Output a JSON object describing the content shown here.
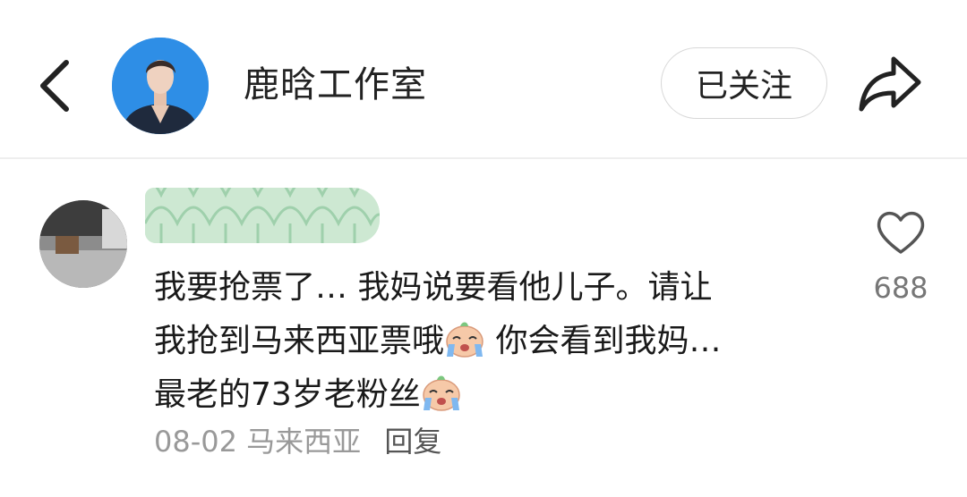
{
  "header": {
    "back_icon": "chevron-left-icon",
    "title": "鹿晗工作室",
    "follow_label": "已关注",
    "share_icon": "share-arrow-icon"
  },
  "comment": {
    "text_line1": "我要抢票了… 我妈说要看他儿子。请让",
    "text_line2_a": "我抢到马来西亚票哦",
    "text_line2_b": " 你会看到我妈…",
    "text_line3": "最老的73岁老粉丝",
    "emoji": "crying-peach-emoji",
    "date": "08-02",
    "location": "马来西亚",
    "reply_label": "回复",
    "like_icon": "heart-outline-icon",
    "like_count": "688"
  }
}
